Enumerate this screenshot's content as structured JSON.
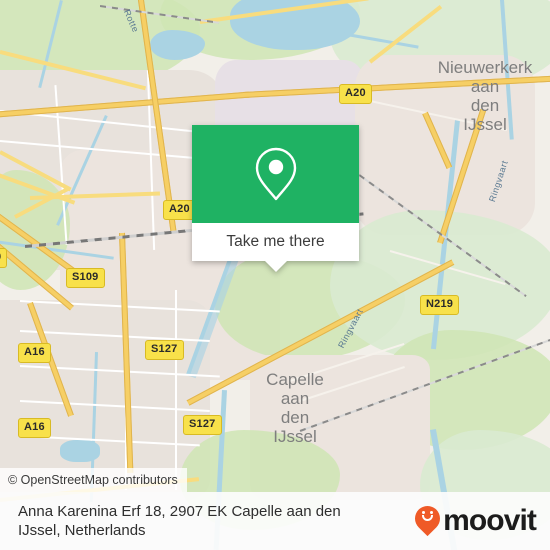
{
  "map": {
    "attribution": "© OpenStreetMap contributors",
    "place_labels": [
      {
        "id": "nieuwerkerk",
        "lines": [
          "Nieuwerkerk",
          "aan",
          "den",
          "IJssel"
        ]
      },
      {
        "id": "capelle",
        "lines": [
          "Capelle",
          "aan",
          "den",
          "IJssel"
        ]
      }
    ],
    "water_labels": [
      "Rotte",
      "Ringvaart",
      "Ringvaart"
    ],
    "road_shields": [
      "A20",
      "A20",
      "S109",
      "A16",
      "A16",
      "S127",
      "S127",
      "N219"
    ],
    "colors": {
      "land": "#f2efe9",
      "green": "#cfe5b4",
      "water": "#aad3e3",
      "motorway": "#f6cf65",
      "shield_fill": "#f8e14a"
    }
  },
  "callout": {
    "icon": "map-pin-icon",
    "button_label": "Take me there",
    "accent_color": "#1fb263"
  },
  "footer": {
    "address_line1": "Anna Karenina Erf 18, 2907 EK Capelle aan den",
    "address_line2": "IJssel, Netherlands",
    "brand": "moovit",
    "brand_color": "#ef5a27"
  }
}
